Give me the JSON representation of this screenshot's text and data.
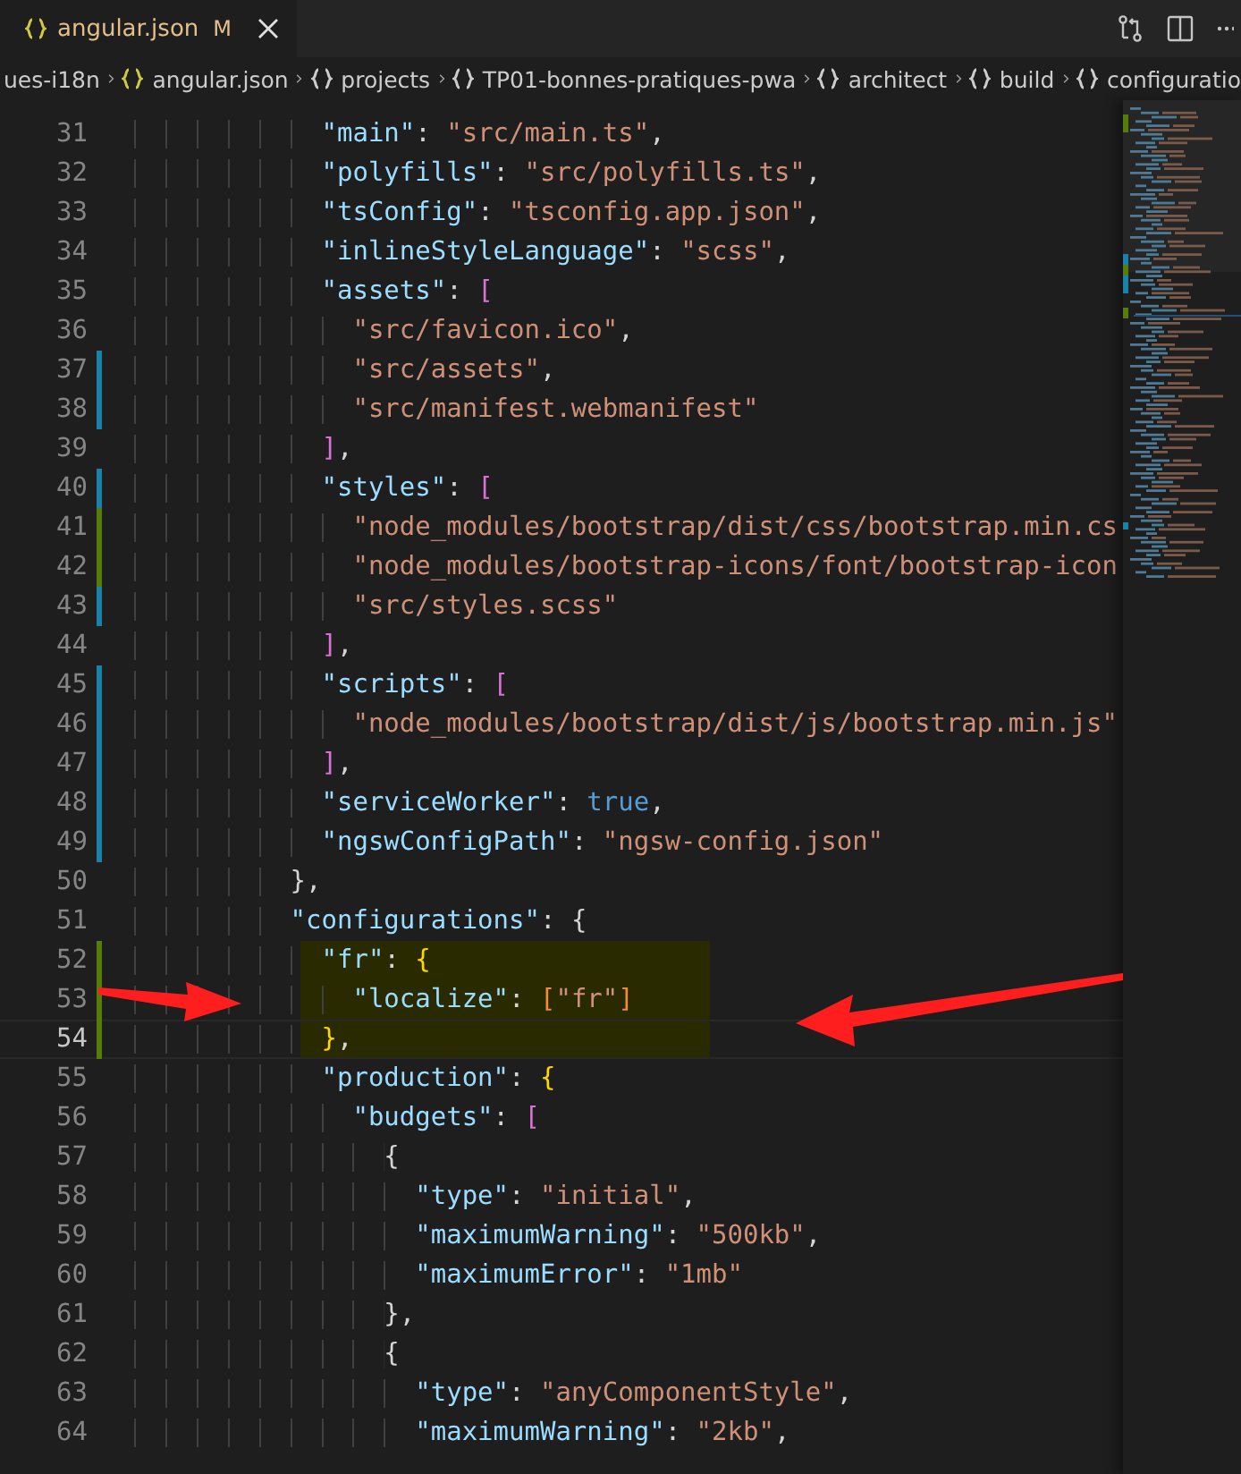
{
  "tab": {
    "title": "angular.json",
    "status": "M",
    "selected": true
  },
  "breadcrumbs": [
    "ues-i18n",
    "angular.json",
    "projects",
    "TP01-bonnes-pratiques-pwa",
    "architect",
    "build",
    "configuratio"
  ],
  "lines": [
    {
      "number": "31",
      "added": false,
      "modified": false,
      "current": false,
      "highlighted": false,
      "tokens": [
        {
          "kind": "key",
          "t": "            \"main\""
        },
        {
          "kind": "punct",
          "t": ": "
        },
        {
          "kind": "string",
          "t": "\"src/main.ts\""
        },
        {
          "kind": "punct",
          "t": ","
        }
      ]
    },
    {
      "number": "32",
      "added": false,
      "modified": false,
      "current": false,
      "highlighted": false,
      "tokens": [
        {
          "kind": "key",
          "t": "            \"polyfills\""
        },
        {
          "kind": "punct",
          "t": ": "
        },
        {
          "kind": "string",
          "t": "\"src/polyfills.ts\""
        },
        {
          "kind": "punct",
          "t": ","
        }
      ]
    },
    {
      "number": "33",
      "added": false,
      "modified": false,
      "current": false,
      "highlighted": false,
      "tokens": [
        {
          "kind": "key",
          "t": "            \"tsConfig\""
        },
        {
          "kind": "punct",
          "t": ": "
        },
        {
          "kind": "string",
          "t": "\"tsconfig.app.json\""
        },
        {
          "kind": "punct",
          "t": ","
        }
      ]
    },
    {
      "number": "34",
      "added": false,
      "modified": false,
      "current": false,
      "highlighted": false,
      "tokens": [
        {
          "kind": "key",
          "t": "            \"inlineStyleLanguage\""
        },
        {
          "kind": "punct",
          "t": ": "
        },
        {
          "kind": "string",
          "t": "\"scss\""
        },
        {
          "kind": "punct",
          "t": ","
        }
      ]
    },
    {
      "number": "35",
      "added": false,
      "modified": false,
      "current": false,
      "highlighted": false,
      "tokens": [
        {
          "kind": "key",
          "t": "            \"assets\""
        },
        {
          "kind": "punct",
          "t": ": "
        },
        {
          "kind": "bracket2",
          "t": "["
        }
      ]
    },
    {
      "number": "36",
      "added": false,
      "modified": false,
      "current": false,
      "highlighted": false,
      "tokens": [
        {
          "kind": "string",
          "t": "              \"src/favicon.ico\""
        },
        {
          "kind": "punct",
          "t": ","
        }
      ]
    },
    {
      "number": "37",
      "added": false,
      "modified": true,
      "current": false,
      "highlighted": false,
      "tokens": [
        {
          "kind": "string",
          "t": "              \"src/assets\""
        },
        {
          "kind": "punct",
          "t": ","
        }
      ]
    },
    {
      "number": "38",
      "added": false,
      "modified": true,
      "current": false,
      "highlighted": false,
      "tokens": [
        {
          "kind": "string",
          "t": "              \"src/manifest.webmanifest\""
        }
      ]
    },
    {
      "number": "39",
      "added": false,
      "modified": false,
      "current": false,
      "highlighted": false,
      "tokens": [
        {
          "kind": "bracket2",
          "t": "            ]"
        },
        {
          "kind": "punct",
          "t": ","
        }
      ]
    },
    {
      "number": "40",
      "added": false,
      "modified": true,
      "current": false,
      "highlighted": false,
      "tokens": [
        {
          "kind": "key",
          "t": "            \"styles\""
        },
        {
          "kind": "punct",
          "t": ": "
        },
        {
          "kind": "bracket2",
          "t": "["
        }
      ]
    },
    {
      "number": "41",
      "added": true,
      "modified": false,
      "current": false,
      "highlighted": false,
      "tokens": [
        {
          "kind": "string",
          "t": "              \"node_modules/bootstrap/dist/css/bootstrap.min.cs"
        }
      ]
    },
    {
      "number": "42",
      "added": true,
      "modified": false,
      "current": false,
      "highlighted": false,
      "tokens": [
        {
          "kind": "string",
          "t": "              \"node_modules/bootstrap-icons/font/bootstrap-icon"
        }
      ]
    },
    {
      "number": "43",
      "added": false,
      "modified": true,
      "current": false,
      "highlighted": false,
      "tokens": [
        {
          "kind": "string",
          "t": "              \"src/styles.scss\""
        }
      ]
    },
    {
      "number": "44",
      "added": false,
      "modified": false,
      "current": false,
      "highlighted": false,
      "tokens": [
        {
          "kind": "bracket2",
          "t": "            ]"
        },
        {
          "kind": "punct",
          "t": ","
        }
      ]
    },
    {
      "number": "45",
      "added": false,
      "modified": true,
      "current": false,
      "highlighted": false,
      "tokens": [
        {
          "kind": "key",
          "t": "            \"scripts\""
        },
        {
          "kind": "punct",
          "t": ": "
        },
        {
          "kind": "bracket2",
          "t": "["
        }
      ]
    },
    {
      "number": "46",
      "added": false,
      "modified": true,
      "current": false,
      "highlighted": false,
      "tokens": [
        {
          "kind": "string",
          "t": "              \"node_modules/bootstrap/dist/js/bootstrap.min.js\""
        }
      ]
    },
    {
      "number": "47",
      "added": false,
      "modified": true,
      "current": false,
      "highlighted": false,
      "tokens": [
        {
          "kind": "bracket2",
          "t": "            ]"
        },
        {
          "kind": "punct",
          "t": ","
        }
      ]
    },
    {
      "number": "48",
      "added": false,
      "modified": true,
      "current": false,
      "highlighted": false,
      "tokens": [
        {
          "kind": "key",
          "t": "            \"serviceWorker\""
        },
        {
          "kind": "punct",
          "t": ": "
        },
        {
          "kind": "bool",
          "t": "true"
        },
        {
          "kind": "punct",
          "t": ","
        }
      ]
    },
    {
      "number": "49",
      "added": false,
      "modified": true,
      "current": false,
      "highlighted": false,
      "tokens": [
        {
          "kind": "key",
          "t": "            \"ngswConfigPath\""
        },
        {
          "kind": "punct",
          "t": ": "
        },
        {
          "kind": "string",
          "t": "\"ngsw-config.json\""
        }
      ]
    },
    {
      "number": "50",
      "added": false,
      "modified": false,
      "current": false,
      "highlighted": false,
      "tokens": [
        {
          "kind": "bracket3",
          "t": "          }"
        },
        {
          "kind": "punct",
          "t": ","
        }
      ]
    },
    {
      "number": "51",
      "added": false,
      "modified": false,
      "current": false,
      "highlighted": false,
      "tokens": [
        {
          "kind": "key",
          "t": "          \"configurations\""
        },
        {
          "kind": "punct",
          "t": ": "
        },
        {
          "kind": "bracket3",
          "t": "{"
        }
      ]
    },
    {
      "number": "52",
      "added": true,
      "modified": false,
      "current": false,
      "highlighted": true,
      "tokens": [
        {
          "kind": "key",
          "t": "            \"fr\""
        },
        {
          "kind": "punct",
          "t": ": "
        },
        {
          "kind": "bracket1",
          "t": "{"
        }
      ]
    },
    {
      "number": "53",
      "added": true,
      "modified": false,
      "current": false,
      "highlighted": true,
      "tokens": [
        {
          "kind": "key",
          "t": "              \"localize\""
        },
        {
          "kind": "punct",
          "t": ": "
        },
        {
          "kind": "bracket4",
          "t": "["
        },
        {
          "kind": "string",
          "t": "\"fr\""
        },
        {
          "kind": "bracket4",
          "t": "]"
        }
      ]
    },
    {
      "number": "54",
      "added": true,
      "modified": false,
      "current": true,
      "highlighted": true,
      "tokens": [
        {
          "kind": "bracket1",
          "t": "            }"
        },
        {
          "kind": "punct",
          "t": ","
        }
      ]
    },
    {
      "number": "55",
      "added": false,
      "modified": false,
      "current": false,
      "highlighted": false,
      "tokens": [
        {
          "kind": "key",
          "t": "            \"production\""
        },
        {
          "kind": "punct",
          "t": ": "
        },
        {
          "kind": "bracket1",
          "t": "{"
        }
      ]
    },
    {
      "number": "56",
      "added": false,
      "modified": false,
      "current": false,
      "highlighted": false,
      "tokens": [
        {
          "kind": "key",
          "t": "              \"budgets\""
        },
        {
          "kind": "punct",
          "t": ": "
        },
        {
          "kind": "bracket2",
          "t": "["
        }
      ]
    },
    {
      "number": "57",
      "added": false,
      "modified": false,
      "current": false,
      "highlighted": false,
      "tokens": [
        {
          "kind": "bracket3",
          "t": "                {"
        }
      ]
    },
    {
      "number": "58",
      "added": false,
      "modified": false,
      "current": false,
      "highlighted": false,
      "tokens": [
        {
          "kind": "key",
          "t": "                  \"type\""
        },
        {
          "kind": "punct",
          "t": ": "
        },
        {
          "kind": "string",
          "t": "\"initial\""
        },
        {
          "kind": "punct",
          "t": ","
        }
      ]
    },
    {
      "number": "59",
      "added": false,
      "modified": false,
      "current": false,
      "highlighted": false,
      "tokens": [
        {
          "kind": "key",
          "t": "                  \"maximumWarning\""
        },
        {
          "kind": "punct",
          "t": ": "
        },
        {
          "kind": "string",
          "t": "\"500kb\""
        },
        {
          "kind": "punct",
          "t": ","
        }
      ]
    },
    {
      "number": "60",
      "added": false,
      "modified": false,
      "current": false,
      "highlighted": false,
      "tokens": [
        {
          "kind": "key",
          "t": "                  \"maximumError\""
        },
        {
          "kind": "punct",
          "t": ": "
        },
        {
          "kind": "string",
          "t": "\"1mb\""
        }
      ]
    },
    {
      "number": "61",
      "added": false,
      "modified": false,
      "current": false,
      "highlighted": false,
      "tokens": [
        {
          "kind": "bracket3",
          "t": "                }"
        },
        {
          "kind": "punct",
          "t": ","
        }
      ]
    },
    {
      "number": "62",
      "added": false,
      "modified": false,
      "current": false,
      "highlighted": false,
      "tokens": [
        {
          "kind": "bracket3",
          "t": "                {"
        }
      ]
    },
    {
      "number": "63",
      "added": false,
      "modified": false,
      "current": false,
      "highlighted": false,
      "tokens": [
        {
          "kind": "key",
          "t": "                  \"type\""
        },
        {
          "kind": "punct",
          "t": ": "
        },
        {
          "kind": "string",
          "t": "\"anyComponentStyle\""
        },
        {
          "kind": "punct",
          "t": ","
        }
      ]
    },
    {
      "number": "64",
      "added": false,
      "modified": false,
      "current": false,
      "highlighted": false,
      "tokens": [
        {
          "kind": "key",
          "t": "                  \"maximumWarning\""
        },
        {
          "kind": "punct",
          "t": ": "
        },
        {
          "kind": "string",
          "t": "\"2kb\""
        },
        {
          "kind": "punct",
          "t": ","
        }
      ]
    }
  ]
}
